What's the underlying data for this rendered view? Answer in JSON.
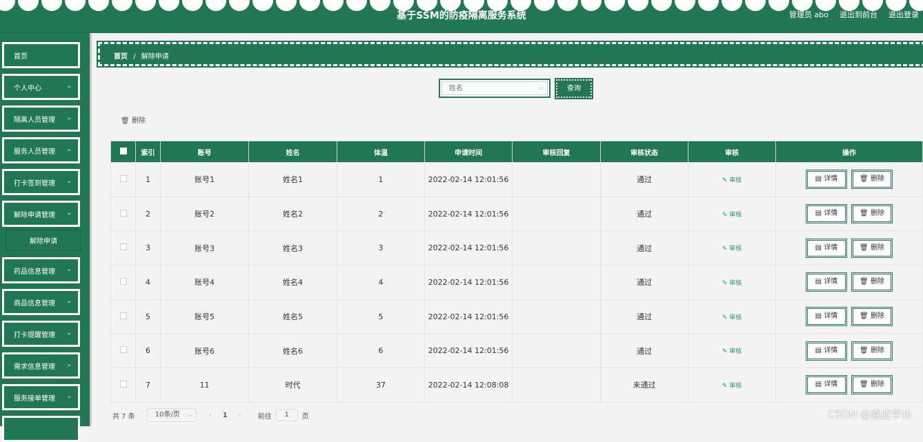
{
  "header": {
    "title": "基于SSM的防疫隔离服务系统",
    "user": "管理员 abo",
    "front": "退出到前台",
    "logout": "退出登录"
  },
  "sidebar": {
    "items": [
      {
        "label": "首页"
      },
      {
        "label": "个人中心"
      },
      {
        "label": "隔离人员管理"
      },
      {
        "label": "服务人员管理"
      },
      {
        "label": "打卡签到管理"
      },
      {
        "label": "解除申请管理"
      },
      {
        "label": "药品信息管理"
      },
      {
        "label": "商品信息管理"
      },
      {
        "label": "打卡提醒管理"
      },
      {
        "label": "需求信息管理"
      },
      {
        "label": "服务接单管理"
      }
    ],
    "sub": "解除申请"
  },
  "breadcrumb": {
    "home": "首页",
    "sep": "/",
    "current": "解除申请"
  },
  "search": {
    "placeholder": "姓名",
    "button": "查询"
  },
  "toolbar": {
    "delete": "删除"
  },
  "table": {
    "headers": [
      "索引",
      "账号",
      "姓名",
      "体温",
      "申请时间",
      "审核回复",
      "审核状态",
      "审核",
      "操作"
    ],
    "rows": [
      [
        "1",
        "账号1",
        "姓名1",
        "1",
        "2022-02-14 12:01:56",
        "",
        "通过"
      ],
      [
        "2",
        "账号2",
        "姓名2",
        "2",
        "2022-02-14 12:01:56",
        "",
        "通过"
      ],
      [
        "3",
        "账号3",
        "姓名3",
        "3",
        "2022-02-14 12:01:56",
        "",
        "通过"
      ],
      [
        "4",
        "账号4",
        "姓名4",
        "4",
        "2022-02-14 12:01:56",
        "",
        "通过"
      ],
      [
        "5",
        "账号5",
        "姓名5",
        "5",
        "2022-02-14 12:01:56",
        "",
        "通过"
      ],
      [
        "6",
        "账号6",
        "姓名6",
        "6",
        "2022-02-14 12:01:56",
        "",
        "通过"
      ],
      [
        "7",
        "11",
        "时代",
        "37",
        "2022-02-14 12:08:08",
        "",
        "未通过"
      ]
    ],
    "audit_label": "审核",
    "detail_label": "详情",
    "delete_label": "删除"
  },
  "pager": {
    "total": "共 7 条",
    "size": "10条/页",
    "page": "1",
    "goto": "前往",
    "goto_value": "1",
    "page_unit": "页"
  },
  "watermark": "CSDN @嘉应学长"
}
